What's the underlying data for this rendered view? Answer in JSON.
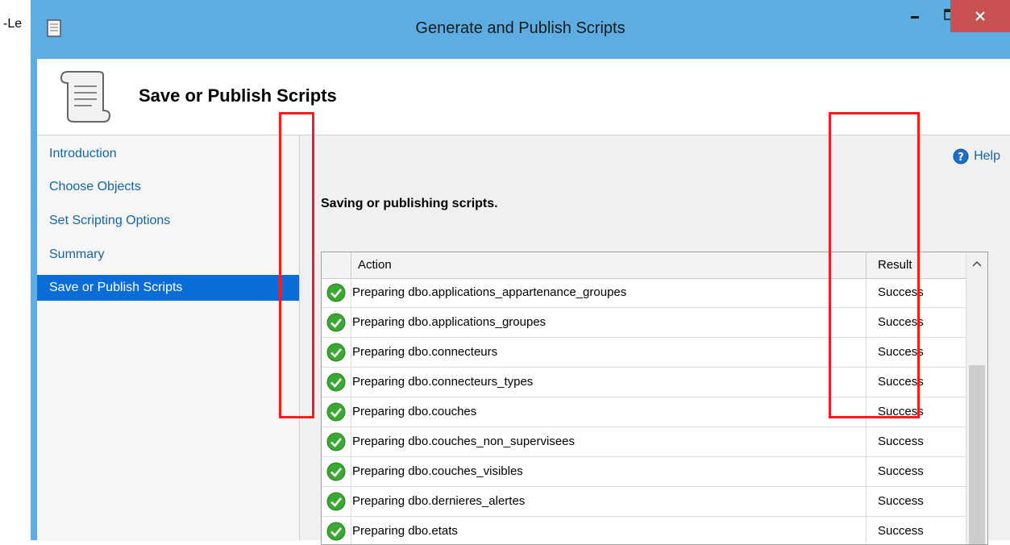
{
  "background": {
    "text": "-Le"
  },
  "window": {
    "title": "Generate and Publish Scripts",
    "buttons": {
      "minimize": "minimize",
      "maximize": "maximize",
      "close": "close"
    }
  },
  "header": {
    "title": "Save or Publish Scripts"
  },
  "nav": {
    "items": [
      {
        "label": "Introduction"
      },
      {
        "label": "Choose Objects"
      },
      {
        "label": "Set Scripting Options"
      },
      {
        "label": "Summary"
      },
      {
        "label": "Save or Publish Scripts",
        "selected": true
      }
    ]
  },
  "main": {
    "help_label": "Help",
    "status": "Saving or publishing scripts.",
    "grid": {
      "headers": {
        "action": "Action",
        "result": "Result"
      },
      "rows": [
        {
          "action": "Preparing dbo.applications_appartenance_groupes",
          "result": "Success"
        },
        {
          "action": "Preparing dbo.applications_groupes",
          "result": "Success"
        },
        {
          "action": "Preparing dbo.connecteurs",
          "result": "Success"
        },
        {
          "action": "Preparing dbo.connecteurs_types",
          "result": "Success"
        },
        {
          "action": "Preparing dbo.couches",
          "result": "Success"
        },
        {
          "action": "Preparing dbo.couches_non_supervisees",
          "result": "Success"
        },
        {
          "action": "Preparing dbo.couches_visibles",
          "result": "Success"
        },
        {
          "action": "Preparing dbo.dernieres_alertes",
          "result": "Success"
        },
        {
          "action": "Preparing dbo.etats",
          "result": "Success"
        }
      ]
    }
  },
  "colors": {
    "title_bar": "#5dade2",
    "close_button": "#c75050",
    "nav_selected": "#0a6cd6",
    "link": "#1464a8",
    "highlight": "#ff1a1a",
    "success_icon": "#3aa832"
  }
}
